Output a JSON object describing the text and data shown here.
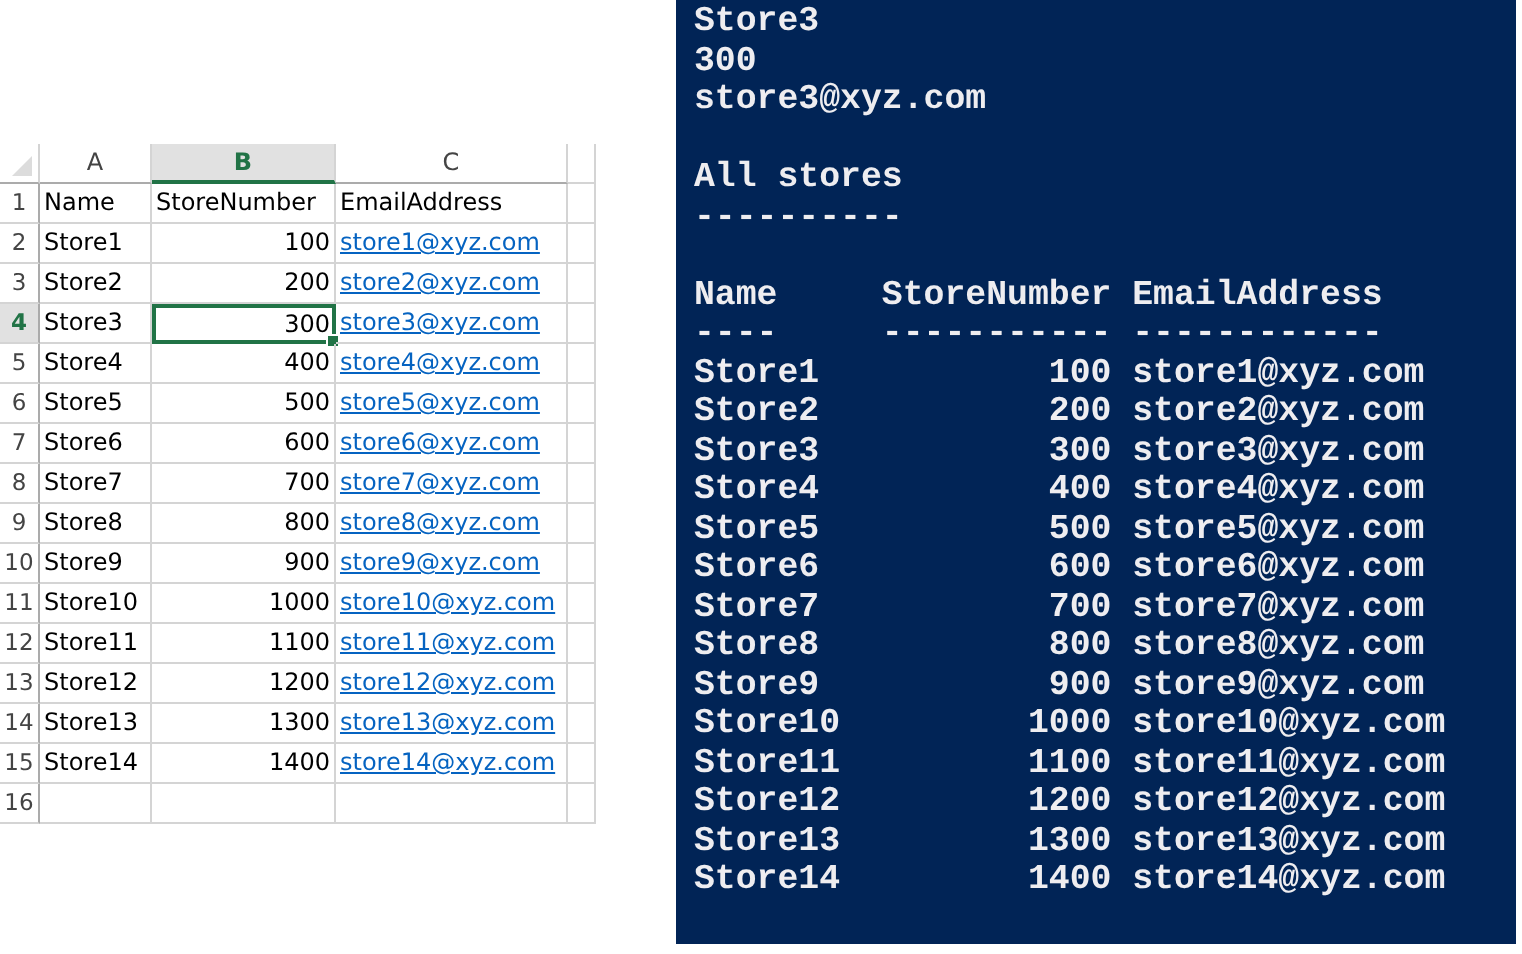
{
  "spreadsheet": {
    "columns": [
      {
        "label": "A",
        "selected": false
      },
      {
        "label": "B",
        "selected": true
      },
      {
        "label": "C",
        "selected": false
      }
    ],
    "rows": [
      {
        "number": "1",
        "selected": false,
        "cells": [
          {
            "text": "Name",
            "kind": "text"
          },
          {
            "text": "StoreNumber",
            "kind": "text"
          },
          {
            "text": "EmailAddress",
            "kind": "text"
          }
        ]
      },
      {
        "number": "2",
        "selected": false,
        "cells": [
          {
            "text": "Store1",
            "kind": "text"
          },
          {
            "text": "100",
            "kind": "number"
          },
          {
            "text": "store1@xyz.com",
            "kind": "link"
          }
        ]
      },
      {
        "number": "3",
        "selected": false,
        "cells": [
          {
            "text": "Store2",
            "kind": "text"
          },
          {
            "text": "200",
            "kind": "number"
          },
          {
            "text": "store2@xyz.com",
            "kind": "link"
          }
        ]
      },
      {
        "number": "4",
        "selected": true,
        "cells": [
          {
            "text": "Store3",
            "kind": "text"
          },
          {
            "text": "300",
            "kind": "number"
          },
          {
            "text": "store3@xyz.com",
            "kind": "link"
          }
        ]
      },
      {
        "number": "5",
        "selected": false,
        "cells": [
          {
            "text": "Store4",
            "kind": "text"
          },
          {
            "text": "400",
            "kind": "number"
          },
          {
            "text": "store4@xyz.com",
            "kind": "link"
          }
        ]
      },
      {
        "number": "6",
        "selected": false,
        "cells": [
          {
            "text": "Store5",
            "kind": "text"
          },
          {
            "text": "500",
            "kind": "number"
          },
          {
            "text": "store5@xyz.com",
            "kind": "link"
          }
        ]
      },
      {
        "number": "7",
        "selected": false,
        "cells": [
          {
            "text": "Store6",
            "kind": "text"
          },
          {
            "text": "600",
            "kind": "number"
          },
          {
            "text": "store6@xyz.com",
            "kind": "link"
          }
        ]
      },
      {
        "number": "8",
        "selected": false,
        "cells": [
          {
            "text": "Store7",
            "kind": "text"
          },
          {
            "text": "700",
            "kind": "number"
          },
          {
            "text": "store7@xyz.com",
            "kind": "link"
          }
        ]
      },
      {
        "number": "9",
        "selected": false,
        "cells": [
          {
            "text": "Store8",
            "kind": "text"
          },
          {
            "text": "800",
            "kind": "number"
          },
          {
            "text": "store8@xyz.com",
            "kind": "link"
          }
        ]
      },
      {
        "number": "10",
        "selected": false,
        "cells": [
          {
            "text": "Store9",
            "kind": "text"
          },
          {
            "text": "900",
            "kind": "number"
          },
          {
            "text": "store9@xyz.com",
            "kind": "link"
          }
        ]
      },
      {
        "number": "11",
        "selected": false,
        "cells": [
          {
            "text": "Store10",
            "kind": "text"
          },
          {
            "text": "1000",
            "kind": "number"
          },
          {
            "text": "store10@xyz.com",
            "kind": "link"
          }
        ]
      },
      {
        "number": "12",
        "selected": false,
        "cells": [
          {
            "text": "Store11",
            "kind": "text"
          },
          {
            "text": "1100",
            "kind": "number"
          },
          {
            "text": "store11@xyz.com",
            "kind": "link"
          }
        ]
      },
      {
        "number": "13",
        "selected": false,
        "cells": [
          {
            "text": "Store12",
            "kind": "text"
          },
          {
            "text": "1200",
            "kind": "number"
          },
          {
            "text": "store12@xyz.com",
            "kind": "link"
          }
        ]
      },
      {
        "number": "14",
        "selected": false,
        "cells": [
          {
            "text": "Store13",
            "kind": "text"
          },
          {
            "text": "1300",
            "kind": "number"
          },
          {
            "text": "store13@xyz.com",
            "kind": "link"
          }
        ]
      },
      {
        "number": "15",
        "selected": false,
        "cells": [
          {
            "text": "Store14",
            "kind": "text"
          },
          {
            "text": "1400",
            "kind": "number"
          },
          {
            "text": "store14@xyz.com",
            "kind": "link"
          }
        ]
      },
      {
        "number": "16",
        "selected": false,
        "cells": []
      }
    ]
  },
  "console": {
    "record": [
      "Store3",
      "300",
      "store3@xyz.com"
    ],
    "heading": "All stores",
    "heading_rule": "----------",
    "columns": [
      {
        "label": "Name",
        "rule": "----",
        "kind": "text"
      },
      {
        "label": "StoreNumber",
        "rule": "-----------",
        "kind": "number"
      },
      {
        "label": "EmailAddress",
        "rule": "------------",
        "kind": "text"
      }
    ],
    "rows": [
      [
        "Store1",
        "100",
        "store1@xyz.com"
      ],
      [
        "Store2",
        "200",
        "store2@xyz.com"
      ],
      [
        "Store3",
        "300",
        "store3@xyz.com"
      ],
      [
        "Store4",
        "400",
        "store4@xyz.com"
      ],
      [
        "Store5",
        "500",
        "store5@xyz.com"
      ],
      [
        "Store6",
        "600",
        "store6@xyz.com"
      ],
      [
        "Store7",
        "700",
        "store7@xyz.com"
      ],
      [
        "Store8",
        "800",
        "store8@xyz.com"
      ],
      [
        "Store9",
        "900",
        "store9@xyz.com"
      ],
      [
        "Store10",
        "1000",
        "store10@xyz.com"
      ],
      [
        "Store11",
        "1100",
        "store11@xyz.com"
      ],
      [
        "Store12",
        "1200",
        "store12@xyz.com"
      ],
      [
        "Store13",
        "1300",
        "store13@xyz.com"
      ],
      [
        "Store14",
        "1400",
        "store14@xyz.com"
      ]
    ]
  }
}
